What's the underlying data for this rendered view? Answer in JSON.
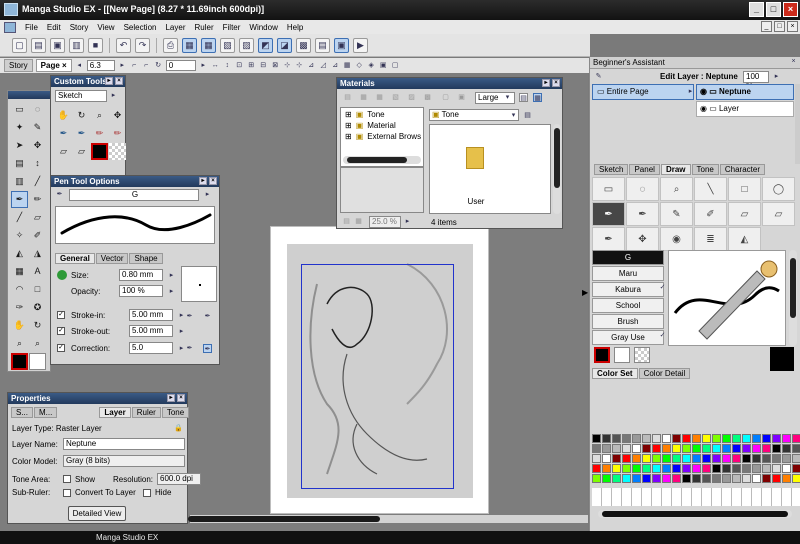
{
  "window": {
    "title": "Manga Studio EX - [[New Page] (8.27 * 11.69inch 600dpi)]",
    "min": "_",
    "max": "□",
    "close": "×"
  },
  "menu": [
    "File",
    "Edit",
    "Story",
    "View",
    "Selection",
    "Layer",
    "Ruler",
    "Filter",
    "Window",
    "Help"
  ],
  "toolbar2": {
    "story_tab": "Story",
    "page_tab": "Page",
    "page_close": "×",
    "zoom_value": "6.3",
    "rotate_value": "0"
  },
  "custom_tools": {
    "title": "Custom Tools",
    "preset": "Sketch"
  },
  "pen_tool_options": {
    "title": "Pen Tool Options",
    "brush_name": "G",
    "tabs": [
      "General",
      "Vector",
      "Shape"
    ],
    "size_label": "Size:",
    "size_value": "0.80 mm",
    "opacity_label": "Opacity:",
    "opacity_value": "100 %",
    "stroke_in_label": "Stroke-in:",
    "stroke_in_value": "5.00 mm",
    "stroke_out_label": "Stroke-out:",
    "stroke_out_value": "5.00 mm",
    "correction_label": "Correction:",
    "correction_value": "5.0"
  },
  "properties": {
    "title": "Properties",
    "tabs": [
      "S...",
      "M...",
      "Layer",
      "Ruler",
      "Tone"
    ],
    "layer_type": "Layer Type: Raster Layer",
    "layer_name_label": "Layer Name:",
    "layer_name_value": "Neptune",
    "color_model_label": "Color Model:",
    "color_model_value": "Gray (8 bits)",
    "tone_area_label": "Tone Area:",
    "show_label": "Show",
    "resolution_label": "Resolution:",
    "resolution_value": "600.0 dpi",
    "sub_ruler_label": "Sub-Ruler:",
    "convert_label": "Convert To Layer",
    "hide_label": "Hide",
    "detailed_button": "Detailed View"
  },
  "materials": {
    "title": "Materials",
    "size_select": "Large",
    "tree": [
      "Tone",
      "Material",
      "External Brows"
    ],
    "location": "Tone",
    "folder_label": "User",
    "zoom": "25.0 %",
    "count": "4 items"
  },
  "assistant": {
    "title": "Beginner's Assistant",
    "edit_layer_label": "Edit Layer : Neptune",
    "opacity": "100 %",
    "entire_page": "Entire Page",
    "layers": [
      "Neptune",
      "Layer"
    ],
    "tool_tabs": [
      "Sketch",
      "Panel",
      "Draw",
      "Tone",
      "Character"
    ],
    "brushes": [
      "G",
      "Maru",
      "Kabura",
      "School",
      "Brush",
      "Gray Use"
    ],
    "color_tabs": [
      "Color Set",
      "Color Detail"
    ]
  },
  "palette_colors": [
    "#000000",
    "#333333",
    "#555555",
    "#777777",
    "#999999",
    "#bbbbbb",
    "#dddddd",
    "#ffffff",
    "#7f0000",
    "#ff0000",
    "#ff7f00",
    "#ffff00",
    "#7fff00",
    "#00ff00",
    "#00ff7f",
    "#00ffff",
    "#007fff",
    "#0000ff",
    "#7f00ff",
    "#ff00ff",
    "#ff007f"
  ],
  "status_text": "Manga Studio EX"
}
